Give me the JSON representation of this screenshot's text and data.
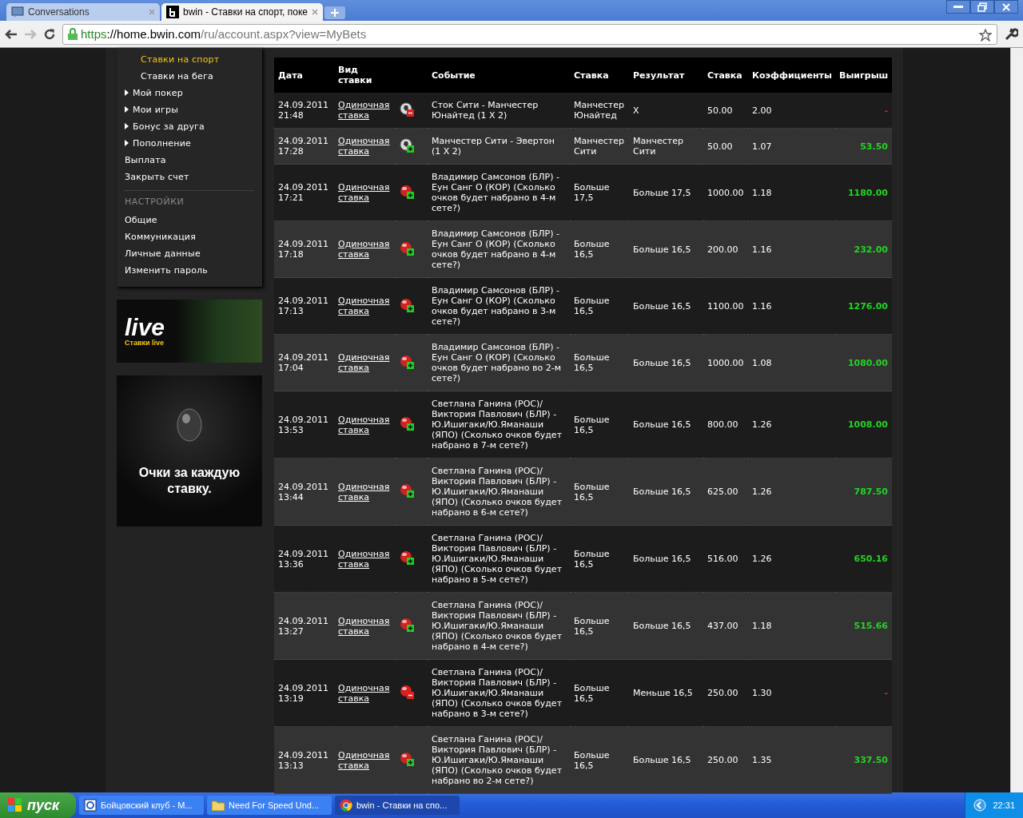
{
  "browser": {
    "tabs": [
      {
        "title": "Conversations",
        "selected": false
      },
      {
        "title": "bwin - Ставки на спорт, поке",
        "selected": true
      }
    ],
    "url_scheme": "https",
    "url_host": "://home.bwin.com",
    "url_path": "/ru/account.aspx?view=MyBets"
  },
  "sidebar": {
    "items": [
      {
        "label": "Ставки на спорт",
        "kind": "sub",
        "selected": true
      },
      {
        "label": "Ставки на бега",
        "kind": "sub",
        "selected": false
      },
      {
        "label": "Мой покер",
        "kind": "arrow",
        "selected": false
      },
      {
        "label": "Мои игры",
        "kind": "arrow",
        "selected": false
      },
      {
        "label": "Бонус за друга",
        "kind": "arrow",
        "selected": false
      },
      {
        "label": "Пополнение",
        "kind": "arrow",
        "selected": false
      },
      {
        "label": "Выплата",
        "kind": "plain",
        "selected": false
      },
      {
        "label": "Закрыть счет",
        "kind": "plain",
        "selected": false
      }
    ],
    "settings_heading": "НАСТРОЙКИ",
    "settings_items": [
      "Общие",
      "Коммуникация",
      "Личные данные",
      "Изменить пароль"
    ]
  },
  "live_banner": {
    "title": "live",
    "subtitle": "Ставки live"
  },
  "points_banner": {
    "text": "Очки за каждую ставку."
  },
  "table": {
    "columns": [
      "Дата",
      "Вид ставки",
      "",
      "Событие",
      "Ставка",
      "Результат",
      "Ставка",
      "Коэффициенты",
      "Выигрыш"
    ],
    "rows": [
      {
        "date": "24.09.2011",
        "time": "21:48",
        "type": "Одиночная ставка",
        "kind": "football",
        "won": false,
        "event": "Сток Сити - Манчестер Юнайтед (1 X 2)",
        "pick": "Манчестер Юнайтед",
        "result": "X",
        "stake": "50.00",
        "odds": "2.00",
        "payout": "-"
      },
      {
        "date": "24.09.2011",
        "time": "17:28",
        "type": "Одиночная ставка",
        "kind": "football",
        "won": true,
        "event": "Манчестер Сити - Эвертон (1 X 2)",
        "pick": "Манчестер Сити",
        "result": "Манчестер Сити",
        "stake": "50.00",
        "odds": "1.07",
        "payout": "53.50"
      },
      {
        "date": "24.09.2011",
        "time": "17:21",
        "type": "Одиночная ставка",
        "kind": "tabletennis",
        "won": true,
        "event": "Владимир Самсонов (БЛР) - Еун Санг О (КОР) (Сколько очков будет набрано в 4-м сете?)",
        "pick": "Больше 17,5",
        "result": "Больше 17,5",
        "stake": "1000.00",
        "odds": "1.18",
        "payout": "1180.00"
      },
      {
        "date": "24.09.2011",
        "time": "17:18",
        "type": "Одиночная ставка",
        "kind": "tabletennis",
        "won": true,
        "event": "Владимир Самсонов (БЛР) - Еун Санг О (КОР) (Сколько очков будет набрано в 4-м сете?)",
        "pick": "Больше 16,5",
        "result": "Больше 16,5",
        "stake": "200.00",
        "odds": "1.16",
        "payout": "232.00"
      },
      {
        "date": "24.09.2011",
        "time": "17:13",
        "type": "Одиночная ставка",
        "kind": "tabletennis",
        "won": true,
        "event": "Владимир Самсонов (БЛР) - Еун Санг О (КОР) (Сколько очков будет набрано в 3-м сете?)",
        "pick": "Больше 16,5",
        "result": "Больше 16,5",
        "stake": "1100.00",
        "odds": "1.16",
        "payout": "1276.00"
      },
      {
        "date": "24.09.2011",
        "time": "17:04",
        "type": "Одиночная ставка",
        "kind": "tabletennis",
        "won": true,
        "event": "Владимир Самсонов (БЛР) - Еун Санг О (КОР) (Сколько очков будет набрано во 2-м сете?)",
        "pick": "Больше 16,5",
        "result": "Больше 16,5",
        "stake": "1000.00",
        "odds": "1.08",
        "payout": "1080.00"
      },
      {
        "date": "24.09.2011",
        "time": "13:53",
        "type": "Одиночная ставка",
        "kind": "tabletennis",
        "won": true,
        "event": "Светлана Ганина (РОС)/ Виктория Павлович (БЛР) - Ю.Ишигаки/Ю.Яманаши (ЯПО) (Сколько очков будет набрано в 7-м сете?)",
        "pick": "Больше 16,5",
        "result": "Больше 16,5",
        "stake": "800.00",
        "odds": "1.26",
        "payout": "1008.00"
      },
      {
        "date": "24.09.2011",
        "time": "13:44",
        "type": "Одиночная ставка",
        "kind": "tabletennis",
        "won": true,
        "event": "Светлана Ганина (РОС)/ Виктория Павлович (БЛР) - Ю.Ишигаки/Ю.Яманаши (ЯПО) (Сколько очков будет набрано в 6-м сете?)",
        "pick": "Больше 16,5",
        "result": "Больше 16,5",
        "stake": "625.00",
        "odds": "1.26",
        "payout": "787.50"
      },
      {
        "date": "24.09.2011",
        "time": "13:36",
        "type": "Одиночная ставка",
        "kind": "tabletennis",
        "won": true,
        "event": "Светлана Ганина (РОС)/ Виктория Павлович (БЛР) - Ю.Ишигаки/Ю.Яманаши (ЯПО) (Сколько очков будет набрано в 5-м сете?)",
        "pick": "Больше 16,5",
        "result": "Больше 16,5",
        "stake": "516.00",
        "odds": "1.26",
        "payout": "650.16"
      },
      {
        "date": "24.09.2011",
        "time": "13:27",
        "type": "Одиночная ставка",
        "kind": "tabletennis",
        "won": true,
        "event": "Светлана Ганина (РОС)/ Виктория Павлович (БЛР) - Ю.Ишигаки/Ю.Яманаши (ЯПО) (Сколько очков будет набрано в 4-м сете?)",
        "pick": "Больше 16,5",
        "result": "Больше 16,5",
        "stake": "437.00",
        "odds": "1.18",
        "payout": "515.66"
      },
      {
        "date": "24.09.2011",
        "time": "13:19",
        "type": "Одиночная ставка",
        "kind": "tabletennis",
        "won": false,
        "event": "Светлана Ганина (РОС)/ Виктория Павлович (БЛР) - Ю.Ишигаки/Ю.Яманаши (ЯПО) (Сколько очков будет набрано в 3-м сете?)",
        "pick": "Больше 16,5",
        "result": "Меньше 16,5",
        "stake": "250.00",
        "odds": "1.30",
        "payout": "-"
      },
      {
        "date": "24.09.2011",
        "time": "13:13",
        "type": "Одиночная ставка",
        "kind": "tabletennis",
        "won": true,
        "event": "Светлана Ганина (РОС)/ Виктория Павлович (БЛР) - Ю.Ишигаки/Ю.Яманаши (ЯПО) (Сколько очков будет набрано во 2-м сете?)",
        "pick": "Больше 16,5",
        "result": "Больше 16,5",
        "stake": "250.00",
        "odds": "1.35",
        "payout": "337.50"
      }
    ]
  },
  "taskbar": {
    "start": "пуск",
    "tasks": [
      {
        "title": "Бойцовский клуб - М...",
        "selected": false
      },
      {
        "title": "Need For Speed Und...",
        "selected": false
      },
      {
        "title": "bwin - Ставки на спо...",
        "selected": true
      }
    ],
    "clock": "22:31"
  }
}
